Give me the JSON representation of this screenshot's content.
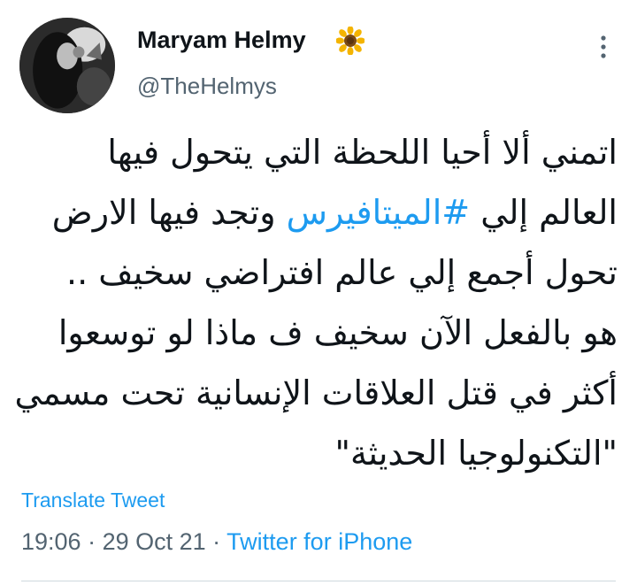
{
  "user": {
    "display_name": "Maryam Helmy",
    "name_emoji_icon": "sunflower-icon",
    "handle": "@TheHelmys"
  },
  "tweet": {
    "lines": [
      {
        "before": "اتمني ألا أحيا اللحظة التي يتحول فيها",
        "hashtag": "",
        "after": ""
      },
      {
        "before": "العالم إلي ",
        "hashtag": "#الميتافيرس",
        "after": " وتجد فيها الارض"
      },
      {
        "before": "تحول أجمع إلي عالم افتراضي سخيف ..",
        "hashtag": "",
        "after": ""
      },
      {
        "before": "هو بالفعل الآن سخيف ف ماذا لو توسعوا",
        "hashtag": "",
        "after": ""
      },
      {
        "before": "أكثر في قتل العلاقات الإنسانية تحت مسمي",
        "hashtag": "",
        "after": ""
      },
      {
        "before": "\"التكنولوجيا الحديثة\"",
        "hashtag": "",
        "after": ""
      }
    ],
    "translate_label": "Translate Tweet",
    "time": "19:06",
    "separator": " · ",
    "date": "29 Oct 21",
    "source": "Twitter for iPhone"
  },
  "colors": {
    "link": "#1d9bf0",
    "secondary": "#536471",
    "text": "#0f1419"
  }
}
